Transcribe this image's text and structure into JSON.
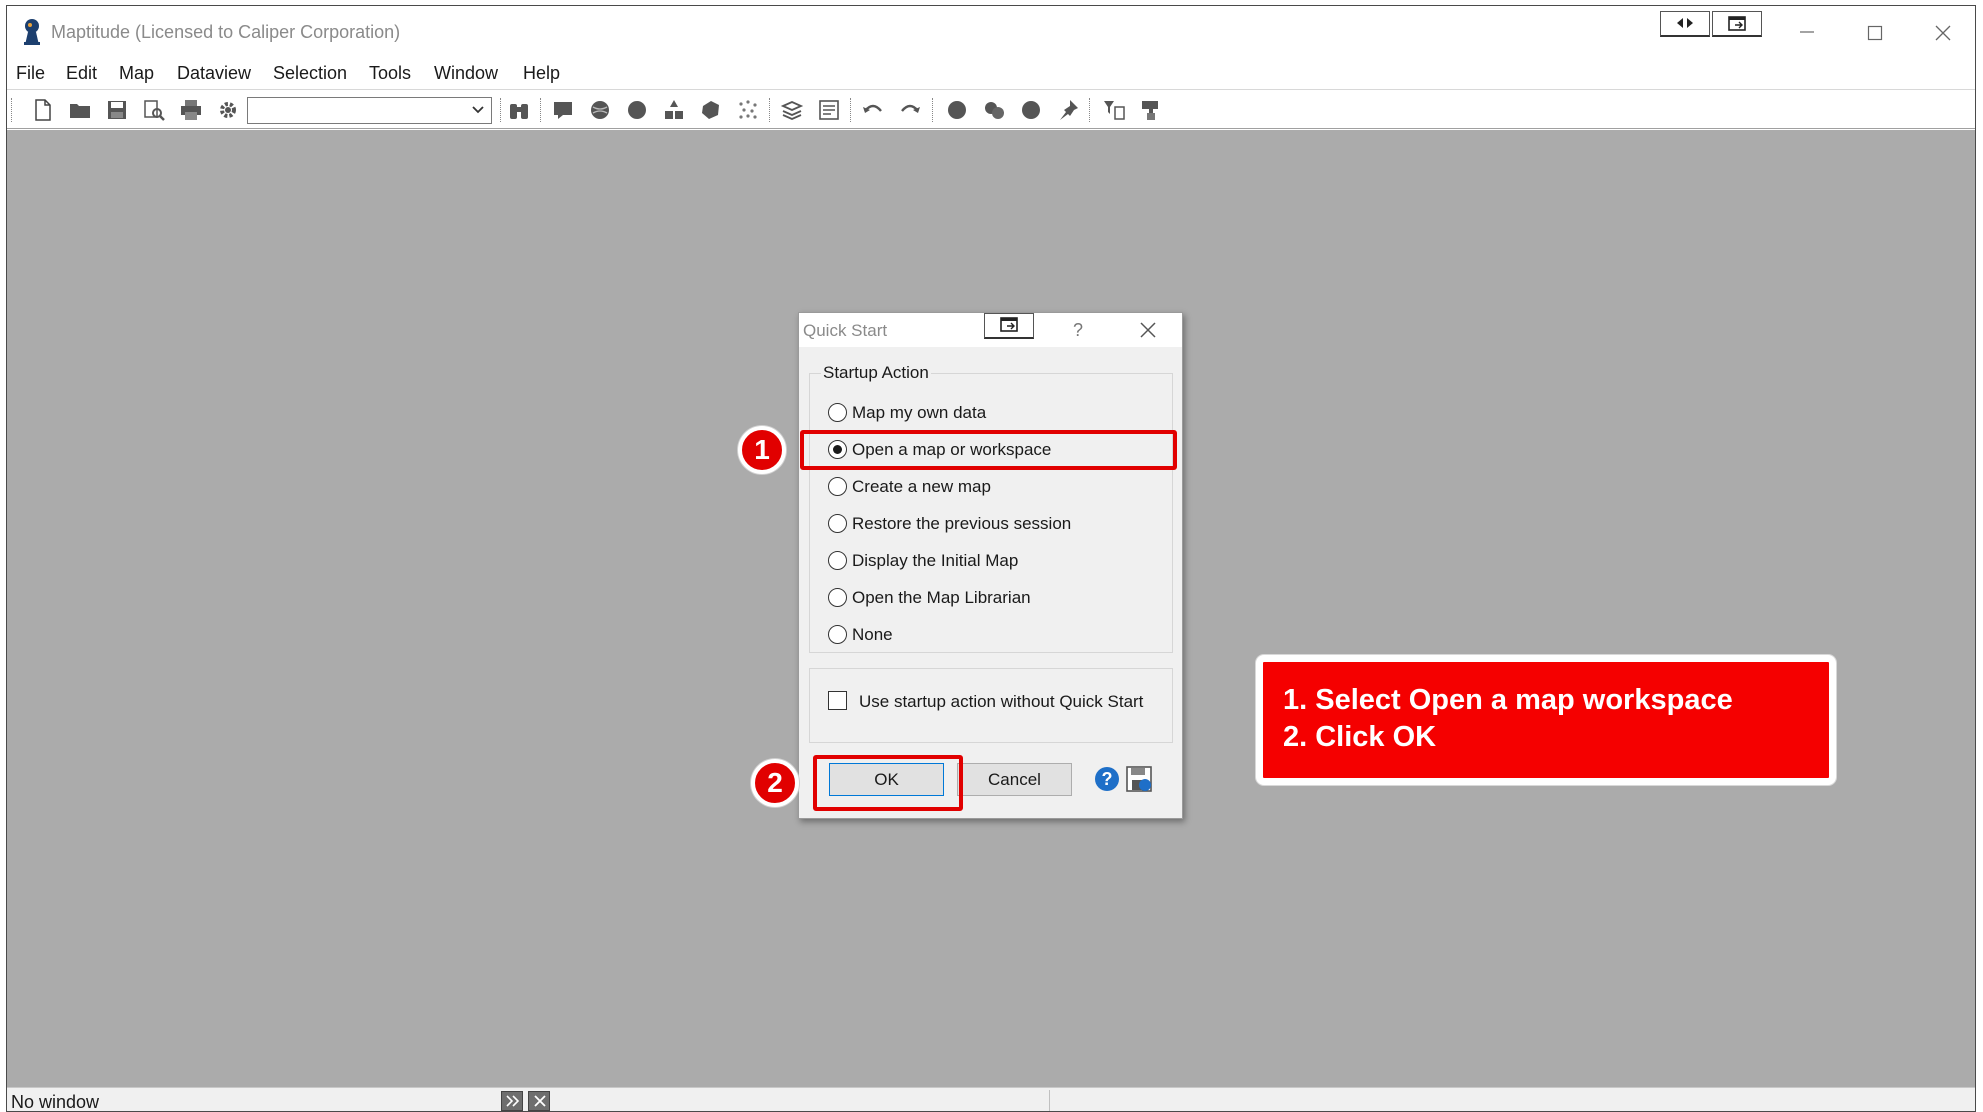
{
  "window": {
    "title": "Maptitude (Licensed to Caliper Corporation)",
    "icon": "maptitude-logo-icon"
  },
  "menu": {
    "items": [
      "File",
      "Edit",
      "Map",
      "Dataview",
      "Selection",
      "Tools",
      "Window",
      "Help"
    ]
  },
  "toolbar": {
    "layer_select_value": "",
    "icons": [
      "new-file-icon",
      "open-folder-icon",
      "save-icon",
      "print-preview-icon",
      "print-icon",
      "settings-icon",
      "find-binoculars-icon",
      "map-icon",
      "globe-icon",
      "circle-icon",
      "shapes-icon",
      "region-icon",
      "scatter-icon",
      "layers-icon",
      "layout-icon",
      "undo-icon",
      "redo-icon",
      "theme-circle-icon",
      "bubble-icon",
      "dot-icon",
      "pin-icon",
      "filter-icon",
      "paint-icon"
    ]
  },
  "dialog": {
    "title": "Quick Start",
    "help_glyph": "?",
    "group_label": "Startup Action",
    "options": [
      {
        "label": "Map my own data",
        "checked": false
      },
      {
        "label": "Open a map or workspace",
        "checked": true
      },
      {
        "label": "Create a new map",
        "checked": false
      },
      {
        "label": "Restore the previous session",
        "checked": false
      },
      {
        "label": "Display the Initial Map",
        "checked": false
      },
      {
        "label": "Open the Map Librarian",
        "checked": false
      },
      {
        "label": "None",
        "checked": false
      }
    ],
    "checkbox_label": "Use startup action without Quick Start",
    "checkbox_checked": false,
    "ok_label": "OK",
    "cancel_label": "Cancel"
  },
  "annotations": {
    "badge_1": "1",
    "badge_2": "2",
    "callout_line_1": "1. Select Open a map workspace",
    "callout_line_2": "2. Click OK",
    "accent_color": "#e10000"
  },
  "statusbar": {
    "text": "No window"
  }
}
